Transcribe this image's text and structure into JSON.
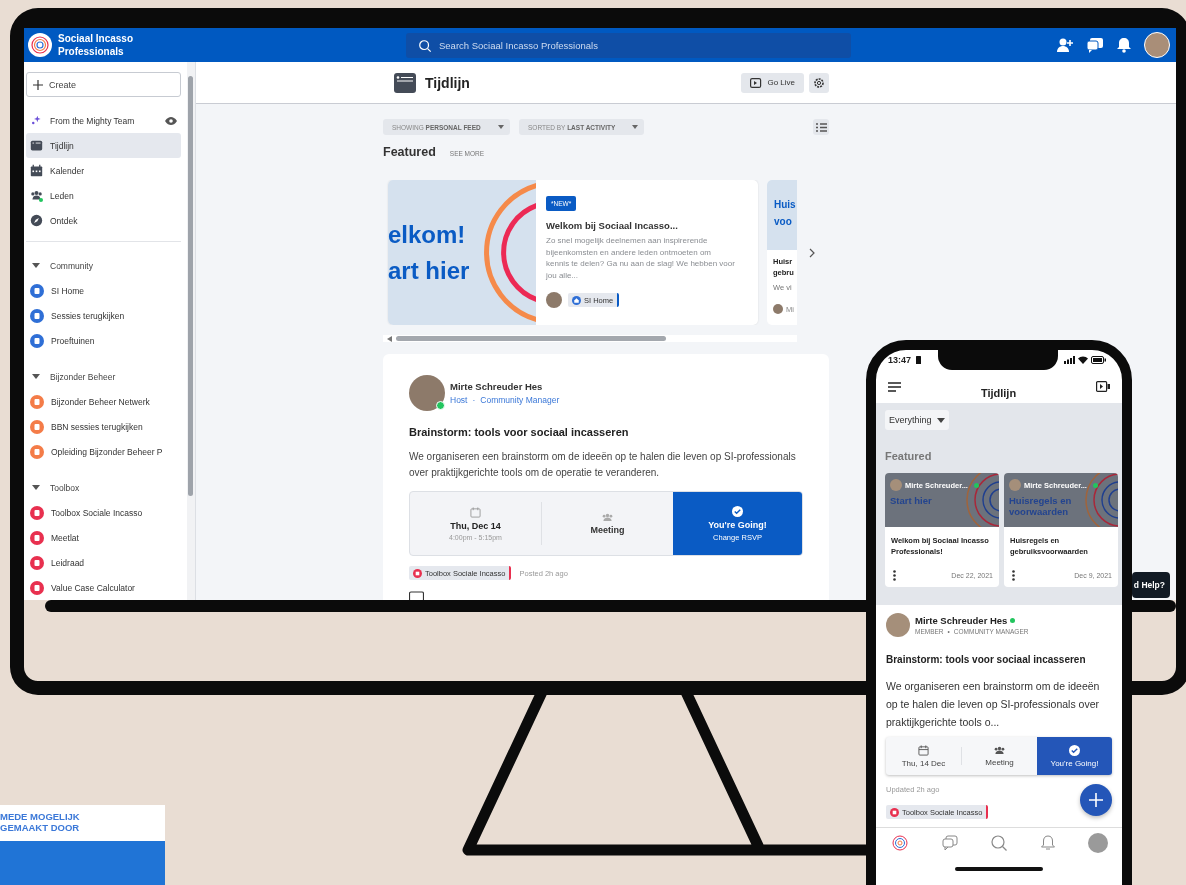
{
  "monitor": {
    "header": {
      "app_title": "Sociaal Incasso Professionals",
      "search_placeholder": "Search Sociaal Incasso Professionals"
    },
    "sidebar": {
      "create_label": "Create",
      "items": [
        {
          "label": "From the Mighty Team",
          "selected": false,
          "notification": false
        },
        {
          "label": "Tijdlijn",
          "selected": true,
          "notification": false
        },
        {
          "label": "Kalender",
          "selected": false,
          "notification": false
        },
        {
          "label": "Leden",
          "selected": false,
          "notification": true
        },
        {
          "label": "Ontdek",
          "selected": false,
          "notification": false
        }
      ],
      "sections": [
        {
          "title": "Community",
          "expanded": true,
          "items": [
            {
              "label": "SI Home",
              "color": "#2f6fd6"
            },
            {
              "label": "Sessies terugkijken",
              "color": "#2f6fd6"
            },
            {
              "label": "Proeftuinen",
              "color": "#2f6fd6"
            }
          ]
        },
        {
          "title": "Bijzonder Beheer",
          "expanded": true,
          "items": [
            {
              "label": "Bijzonder Beheer Netwerk",
              "color": "#f47c48"
            },
            {
              "label": "BBN sessies terugkijken",
              "color": "#f47c48"
            },
            {
              "label": "Opleiding Bijzonder Beheer P",
              "color": "#f47c48"
            }
          ]
        },
        {
          "title": "Toolbox",
          "expanded": true,
          "items": [
            {
              "label": "Toolbox Sociale Incasso",
              "color": "#e8304f"
            },
            {
              "label": "Meetlat",
              "color": "#e8304f"
            },
            {
              "label": "Leidraad",
              "color": "#e8304f"
            },
            {
              "label": "Value Case Calculator",
              "color": "#e8304f"
            }
          ]
        }
      ]
    },
    "page": {
      "title": "Tijdlijn",
      "go_live": "Go Live",
      "filters": [
        {
          "prefix": "SHOWING",
          "value": "PERSONAL FEED"
        },
        {
          "prefix": "SORTED BY",
          "value": "LAST ACTIVITY"
        }
      ],
      "featured": {
        "title": "Featured",
        "see_more": "SEE MORE",
        "card": {
          "image_text": [
            "elkom!",
            "art hier"
          ],
          "badge": "*NEW*",
          "title": "Welkom bij Sociaal Incasso...",
          "excerpt": "Zo snel mogelijk deelnemen aan inspirerende bijeenkomsten en andere leden ontmoeten om kennis te delen? Ga nu aan de slag! We hebben voor jou alle...",
          "space": "SI Home"
        },
        "peek_card": {
          "image_text": [
            "Huis",
            "voo"
          ],
          "title": [
            "Huisr",
            "gebru"
          ],
          "excerpt": "We vi",
          "author": "Mi"
        }
      },
      "post": {
        "author": "Mirte Schreuder Hes",
        "online": true,
        "role": "Host",
        "separator": "·",
        "title_role": "Community Manager",
        "title": "Brainstorm: tools voor sociaal incasseren",
        "body": "We organiseren een brainstorm om de ideeën op te halen die leven op SI-professionals over praktijkgerichte tools om de operatie te veranderen.",
        "event": {
          "date": "Thu, Dec 14",
          "time": "4:00pm - 5:15pm",
          "type": "Meeting",
          "rsvp": "You're Going!",
          "rsvp_action": "Change RSVP",
          "going": true
        },
        "tag": "Toolbox Sociale Incasso",
        "posted": "Posted 2h ago"
      }
    },
    "help_tooltip": "d Help?"
  },
  "phone": {
    "time": "13:47",
    "title": "Tijdlijn",
    "filter": "Everything",
    "featured_title": "Featured",
    "cards": [
      {
        "author": "Mirte Schreuder...",
        "online": true,
        "image_text": "Start hier",
        "title": "Welkom bij Sociaal Incasso Professionals!",
        "date": "Dec 22, 2021"
      },
      {
        "author": "Mirte Schreuder...",
        "online": true,
        "image_text": "Huisregels en voorwaarden",
        "title": "Huisregels en gebruiksvoorwaarden",
        "date": "Dec 9, 2021"
      }
    ],
    "post": {
      "author": "Mirte Schreuder Hes",
      "online": true,
      "role": "MEMBER",
      "separator": "•",
      "title_role": "COMMUNITY MANAGER",
      "title": "Brainstorm: tools voor sociaal incasseren",
      "body": "We organiseren een brainstorm om de ideeën op te halen die leven op SI-professionals over praktijkgerichte tools o...",
      "event": {
        "date": "Thu, 14 Dec",
        "type": "Meeting",
        "rsvp": "You're Going!",
        "going": true
      },
      "updated": "Updated 2h ago",
      "tag": "Toolbox Sociale Incasso"
    }
  },
  "sponsor": {
    "label": "MEDE MOGELIJK GEMAAKT DOOR"
  }
}
